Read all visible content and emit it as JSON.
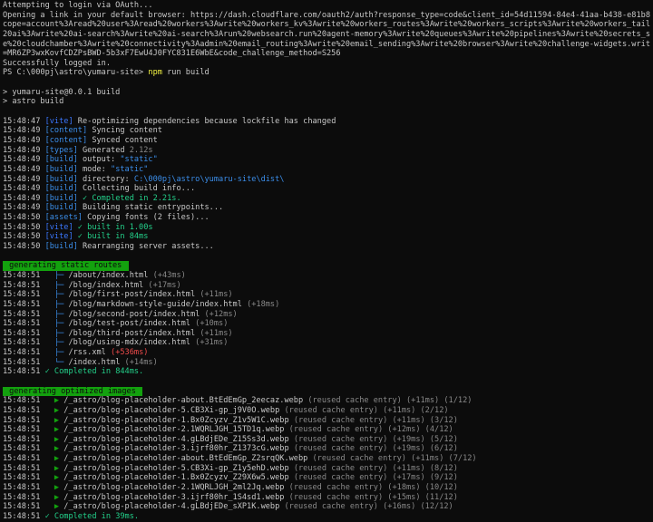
{
  "login": [
    "Attempting to login via OAuth...",
    "Opening a link in your default browser: https://dash.cloudflare.com/oauth2/auth?response_type=code&client_id=54d11594-84e4-41aa-b438-e81b8fa78ee7&",
    "cope=account%3Aread%20user%3Aread%20workers%3Awrite%20workers_kv%3Awrite%20workers_routes%3Awrite%20workers_scripts%3Awrite%20workers_tail%3Aread%20",
    "20ai%3Awrite%20ai-search%3Awrite%20ai-search%3Arun%20websearch.run%20agent-memory%3Awrite%20queues%3Awrite%20pipelines%3Awrite%20secrets_store%3Awr",
    "e%20cloudchamber%3Awrite%20connectivity%3Aadmin%20email_routing%3Awrite%20email_sending%3Awrite%20browser%3Awrite%20challenge-widgets.write%20offli",
    "=MR6ZP3wxKovfCDZPsBWD-5b3xF7EwU4J0FYC831E6WbE&code_challenge_method=S256",
    "Successfully logged in."
  ],
  "prompt": {
    "ps": "PS C:\\000pj\\astro\\yumaru-site> ",
    "cmd": "npm",
    "args": " run build"
  },
  "npm_header": [
    "> yumaru-site@0.0.1 build",
    "> astro build"
  ],
  "build_log": [
    {
      "time": "15:48:47",
      "tag": "[vite]",
      "kind": "vite",
      "msg": " Re-optimizing dependencies because lockfile has changed"
    },
    {
      "time": "15:48:49",
      "tag": "[content]",
      "kind": "content",
      "msg": " Syncing content"
    },
    {
      "time": "15:48:49",
      "tag": "[content]",
      "kind": "content",
      "msg": " Synced content"
    },
    {
      "time": "15:48:49",
      "tag": "[types]",
      "kind": "types",
      "msg": " Generated ",
      "extra": "2.12s",
      "extra_kind": "dim"
    },
    {
      "time": "15:48:49",
      "tag": "[build]",
      "kind": "build",
      "msg": " output: ",
      "extra": "\"static\"",
      "extra_kind": "val"
    },
    {
      "time": "15:48:49",
      "tag": "[build]",
      "kind": "build",
      "msg": " mode: ",
      "extra": "\"static\"",
      "extra_kind": "val"
    },
    {
      "time": "15:48:49",
      "tag": "[build]",
      "kind": "build",
      "msg": " directory: ",
      "extra": "C:\\000pj\\astro\\yumaru-site\\dist\\",
      "extra_kind": "val"
    },
    {
      "time": "15:48:49",
      "tag": "[build]",
      "kind": "build",
      "msg": " Collecting build info..."
    },
    {
      "time": "15:48:49",
      "tag": "[build]",
      "kind": "build",
      "msg": "",
      "extra": " ✓ Completed in 2.21s.",
      "extra_kind": "g"
    },
    {
      "time": "15:48:49",
      "tag": "[build]",
      "kind": "build",
      "msg": " Building static entrypoints..."
    },
    {
      "time": "15:48:50",
      "tag": "[assets]",
      "kind": "assets",
      "msg": " Copying fonts (2 files)..."
    },
    {
      "time": "15:48:50",
      "tag": "[vite]",
      "kind": "vite",
      "msg": "",
      "extra": " ✓ built in 1.00s",
      "extra_kind": "g"
    },
    {
      "time": "15:48:50",
      "tag": "[vite]",
      "kind": "vite",
      "msg": "",
      "extra": " ✓ built in 84ms",
      "extra_kind": "g"
    },
    {
      "time": "15:48:50",
      "tag": "[build]",
      "kind": "build",
      "msg": " Rearranging server assets..."
    }
  ],
  "routes": {
    "banner": " generating static routes ",
    "items": [
      {
        "time": "15:48:51",
        "branch": "├─",
        "path": "/about/index.html",
        "dur": "(+43ms)",
        "warn": false
      },
      {
        "time": "15:48:51",
        "branch": "├─",
        "path": "/blog/index.html",
        "dur": "(+17ms)",
        "warn": false
      },
      {
        "time": "15:48:51",
        "branch": "├─",
        "path": "/blog/first-post/index.html",
        "dur": "(+11ms)",
        "warn": false
      },
      {
        "time": "15:48:51",
        "branch": "├─",
        "path": "/blog/markdown-style-guide/index.html",
        "dur": "(+18ms)",
        "warn": false
      },
      {
        "time": "15:48:51",
        "branch": "├─",
        "path": "/blog/second-post/index.html",
        "dur": "(+12ms)",
        "warn": false
      },
      {
        "time": "15:48:51",
        "branch": "├─",
        "path": "/blog/test-post/index.html",
        "dur": "(+10ms)",
        "warn": false
      },
      {
        "time": "15:48:51",
        "branch": "├─",
        "path": "/blog/third-post/index.html",
        "dur": "(+11ms)",
        "warn": false
      },
      {
        "time": "15:48:51",
        "branch": "├─",
        "path": "/blog/using-mdx/index.html",
        "dur": "(+31ms)",
        "warn": false
      },
      {
        "time": "15:48:51",
        "branch": "├─",
        "path": "/rss.xml",
        "dur": "(+536ms)",
        "warn": true
      },
      {
        "time": "15:48:51",
        "branch": "└─",
        "path": "/index.html",
        "dur": "(+14ms)",
        "warn": false
      }
    ],
    "done_time": "15:48:51",
    "done": " ✓ Completed in 844ms."
  },
  "images": {
    "banner": " generating optimized images ",
    "items": [
      {
        "time": "15:48:51",
        "file": "/_astro/blog-placeholder-about.BtEdEmGp_2eecaz.webp",
        "info": "(reused cache entry) (+11ms) (1/12)"
      },
      {
        "time": "15:48:51",
        "file": "/_astro/blog-placeholder-5.CB3Xi-gp_j9V0O.webp",
        "info": "(reused cache entry) (+11ms) (2/12)"
      },
      {
        "time": "15:48:51",
        "file": "/_astro/blog-placeholder-1.Bx0Zcyzv_Z1v5W1C.webp",
        "info": "(reused cache entry) (+11ms) (3/12)"
      },
      {
        "time": "15:48:51",
        "file": "/_astro/blog-placeholder-2.1WQRLJGH_15TD1q.webp",
        "info": "(reused cache entry) (+12ms) (4/12)"
      },
      {
        "time": "15:48:51",
        "file": "/_astro/blog-placeholder-4.gLBdjEDe_Z15Ss3d.webp",
        "info": "(reused cache entry) (+19ms) (5/12)"
      },
      {
        "time": "15:48:51",
        "file": "/_astro/blog-placeholder-3.ijrf80hr_Z1373cG.webp",
        "info": "(reused cache entry) (+19ms) (6/12)"
      },
      {
        "time": "15:48:51",
        "file": "/_astro/blog-placeholder-about.BtEdEmGp_Z2srqQK.webp",
        "info": "(reused cache entry) (+11ms) (7/12)"
      },
      {
        "time": "15:48:51",
        "file": "/_astro/blog-placeholder-5.CB3Xi-gp_Z1y5ehD.webp",
        "info": "(reused cache entry) (+11ms) (8/12)"
      },
      {
        "time": "15:48:51",
        "file": "/_astro/blog-placeholder-1.Bx0Zcyzv_Z29X6w5.webp",
        "info": "(reused cache entry) (+17ms) (9/12)"
      },
      {
        "time": "15:48:51",
        "file": "/_astro/blog-placeholder-2.1WQRLJGH_2ml2Jq.webp",
        "info": "(reused cache entry) (+18ms) (10/12)"
      },
      {
        "time": "15:48:51",
        "file": "/_astro/blog-placeholder-3.ijrf80hr_1S4sd1.webp",
        "info": "(reused cache entry) (+15ms) (11/12)"
      },
      {
        "time": "15:48:51",
        "file": "/_astro/blog-placeholder-4.gLBdjEDe_sXP1K.webp",
        "info": "(reused cache entry) (+16ms) (12/12)"
      }
    ],
    "done_time": "15:48:51",
    "done": " ✓ Completed in 39ms."
  },
  "colors": {
    "background": "#0c0c0c",
    "text": "#d4d4d4",
    "tag": "#3b8eea",
    "success": "#23d18b",
    "warning": "#f14c4c",
    "banner_bg": "#13a10e",
    "command": "#f5f543"
  }
}
